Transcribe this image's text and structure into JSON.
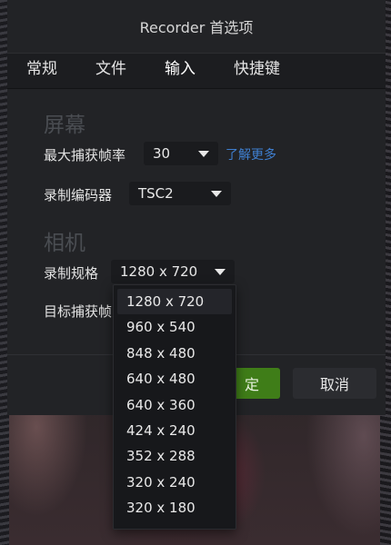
{
  "dialog": {
    "title": "Recorder 首选项"
  },
  "tabs": [
    {
      "label": "常规"
    },
    {
      "label": "文件"
    },
    {
      "label": "输入"
    },
    {
      "label": "快捷键"
    }
  ],
  "screen": {
    "section_title": "屏幕",
    "max_fps": {
      "label": "最大捕获帧率",
      "value": "30",
      "link": "了解更多"
    },
    "encoder": {
      "label": "录制编码器",
      "value": "TSC2"
    }
  },
  "camera": {
    "section_title": "相机",
    "format": {
      "label": "录制规格",
      "value": "1280 x 720"
    },
    "target_fps": {
      "label": "目标捕获帧"
    }
  },
  "footer": {
    "ok_label": "定",
    "cancel_label": "取消"
  },
  "dropdown": {
    "options": [
      "1280 x 720",
      "960 x 540",
      "848 x 480",
      "640 x 480",
      "640 x 360",
      "424 x 240",
      "352 x 288",
      "320 x 240",
      "320 x 180"
    ],
    "selected_index": 0
  },
  "colors": {
    "link": "#3f7fd0",
    "ok_button": "#3f7d18"
  }
}
